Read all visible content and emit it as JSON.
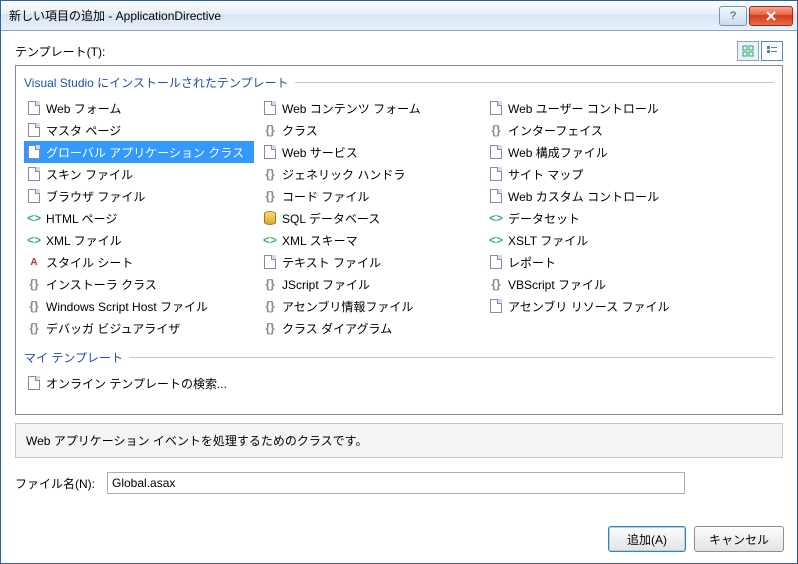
{
  "window": {
    "title": "新しい項目の追加 - ApplicationDirective"
  },
  "labels": {
    "templates": "テンプレート(T):",
    "group_vs": "Visual Studio にインストールされたテンプレート",
    "group_my": "マイ テンプレート",
    "filename": "ファイル名(N):",
    "add": "追加(A)",
    "cancel": "キャンセル"
  },
  "description": "Web アプリケーション イベントを処理するためのクラスです。",
  "filename_value": "Global.asax",
  "selected_index": 2,
  "templates_col1": [
    {
      "label": "Web フォーム",
      "icon": "page"
    },
    {
      "label": "マスタ ページ",
      "icon": "page"
    },
    {
      "label": "グローバル アプリケーション クラス",
      "icon": "page"
    },
    {
      "label": "スキン ファイル",
      "icon": "page"
    },
    {
      "label": "ブラウザ ファイル",
      "icon": "page"
    },
    {
      "label": "HTML ページ",
      "icon": "tag"
    },
    {
      "label": "XML ファイル",
      "icon": "tag"
    },
    {
      "label": "スタイル シート",
      "icon": "css"
    },
    {
      "label": "インストーラ クラス",
      "icon": "code"
    },
    {
      "label": "Windows Script Host ファイル",
      "icon": "code"
    },
    {
      "label": "デバッガ ビジュアライザ",
      "icon": "code"
    }
  ],
  "templates_col2": [
    {
      "label": "Web コンテンツ フォーム",
      "icon": "page"
    },
    {
      "label": "クラス",
      "icon": "code"
    },
    {
      "label": "Web サービス",
      "icon": "page"
    },
    {
      "label": "ジェネリック ハンドラ",
      "icon": "code"
    },
    {
      "label": "コード ファイル",
      "icon": "code"
    },
    {
      "label": "SQL データベース",
      "icon": "db"
    },
    {
      "label": "XML スキーマ",
      "icon": "tag"
    },
    {
      "label": "テキスト ファイル",
      "icon": "page"
    },
    {
      "label": "JScript ファイル",
      "icon": "code"
    },
    {
      "label": "アセンブリ情報ファイル",
      "icon": "code"
    },
    {
      "label": "クラス ダイアグラム",
      "icon": "code"
    }
  ],
  "templates_col3": [
    {
      "label": "Web ユーザー コントロール",
      "icon": "page"
    },
    {
      "label": "インターフェイス",
      "icon": "code"
    },
    {
      "label": "Web 構成ファイル",
      "icon": "page"
    },
    {
      "label": "サイト マップ",
      "icon": "page"
    },
    {
      "label": "Web カスタム コントロール",
      "icon": "page"
    },
    {
      "label": "データセット",
      "icon": "tag"
    },
    {
      "label": "XSLT ファイル",
      "icon": "tag"
    },
    {
      "label": "レポート",
      "icon": "page"
    },
    {
      "label": "VBScript ファイル",
      "icon": "code"
    },
    {
      "label": "アセンブリ リソース ファイル",
      "icon": "page"
    }
  ],
  "my_templates": [
    {
      "label": "オンライン テンプレートの検索...",
      "icon": "page"
    }
  ]
}
